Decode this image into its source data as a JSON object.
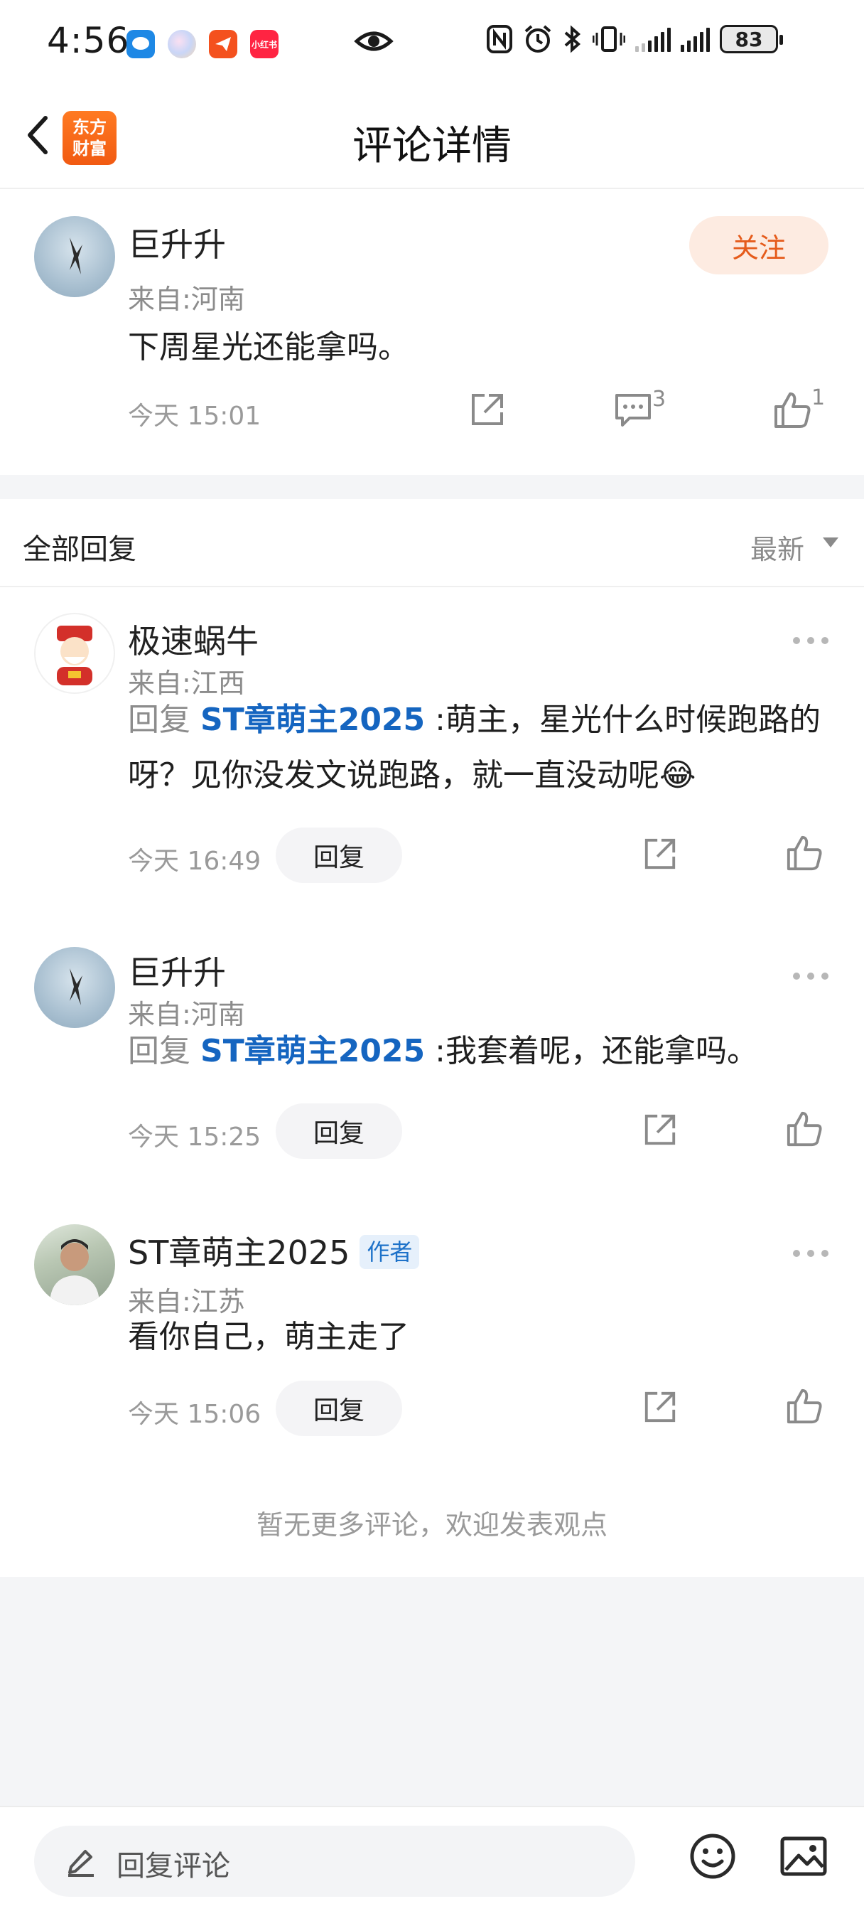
{
  "status_bar": {
    "time": "4:56",
    "battery": "83",
    "app_icons": [
      "message-app-icon",
      "ball-app-icon",
      "paper-plane-app-icon",
      "xiaohongshu-app-icon"
    ],
    "xiaohongshu_text": "小红书"
  },
  "header": {
    "title": "评论详情",
    "logo_line1": "东方",
    "logo_line2": "财富"
  },
  "main_comment": {
    "user": "巨升升",
    "location": "来自:河南",
    "text": "下周星光还能拿吗。",
    "time": "今天 15:01",
    "follow_label": "关注",
    "comment_count": "3",
    "like_count": "1"
  },
  "replies_section": {
    "title": "全部回复",
    "sort_label": "最新"
  },
  "replies": [
    {
      "user": "极速蜗牛",
      "location": "来自:江西",
      "prefix": "回复",
      "mention": "ST章萌主2025",
      "text": ":萌主，星光什么时候跑路的呀？见你没发文说跑路，就一直没动呢😂",
      "time": "今天 16:49",
      "reply_label": "回复"
    },
    {
      "user": "巨升升",
      "location": "来自:河南",
      "prefix": "回复",
      "mention": "ST章萌主2025",
      "text": ":我套着呢，还能拿吗。",
      "time": "今天 15:25",
      "reply_label": "回复"
    },
    {
      "user": "ST章萌主2025",
      "badge": "作者",
      "location": "来自:江苏",
      "text": "看你自己，萌主走了",
      "time": "今天 15:06",
      "reply_label": "回复"
    }
  ],
  "end_note": "暂无更多评论，欢迎发表观点",
  "bottom_bar": {
    "input_placeholder": "回复评论"
  },
  "colors": {
    "accent_orange": "#e55b1b",
    "mention_blue": "#1565c0",
    "background": "#f4f5f7"
  }
}
